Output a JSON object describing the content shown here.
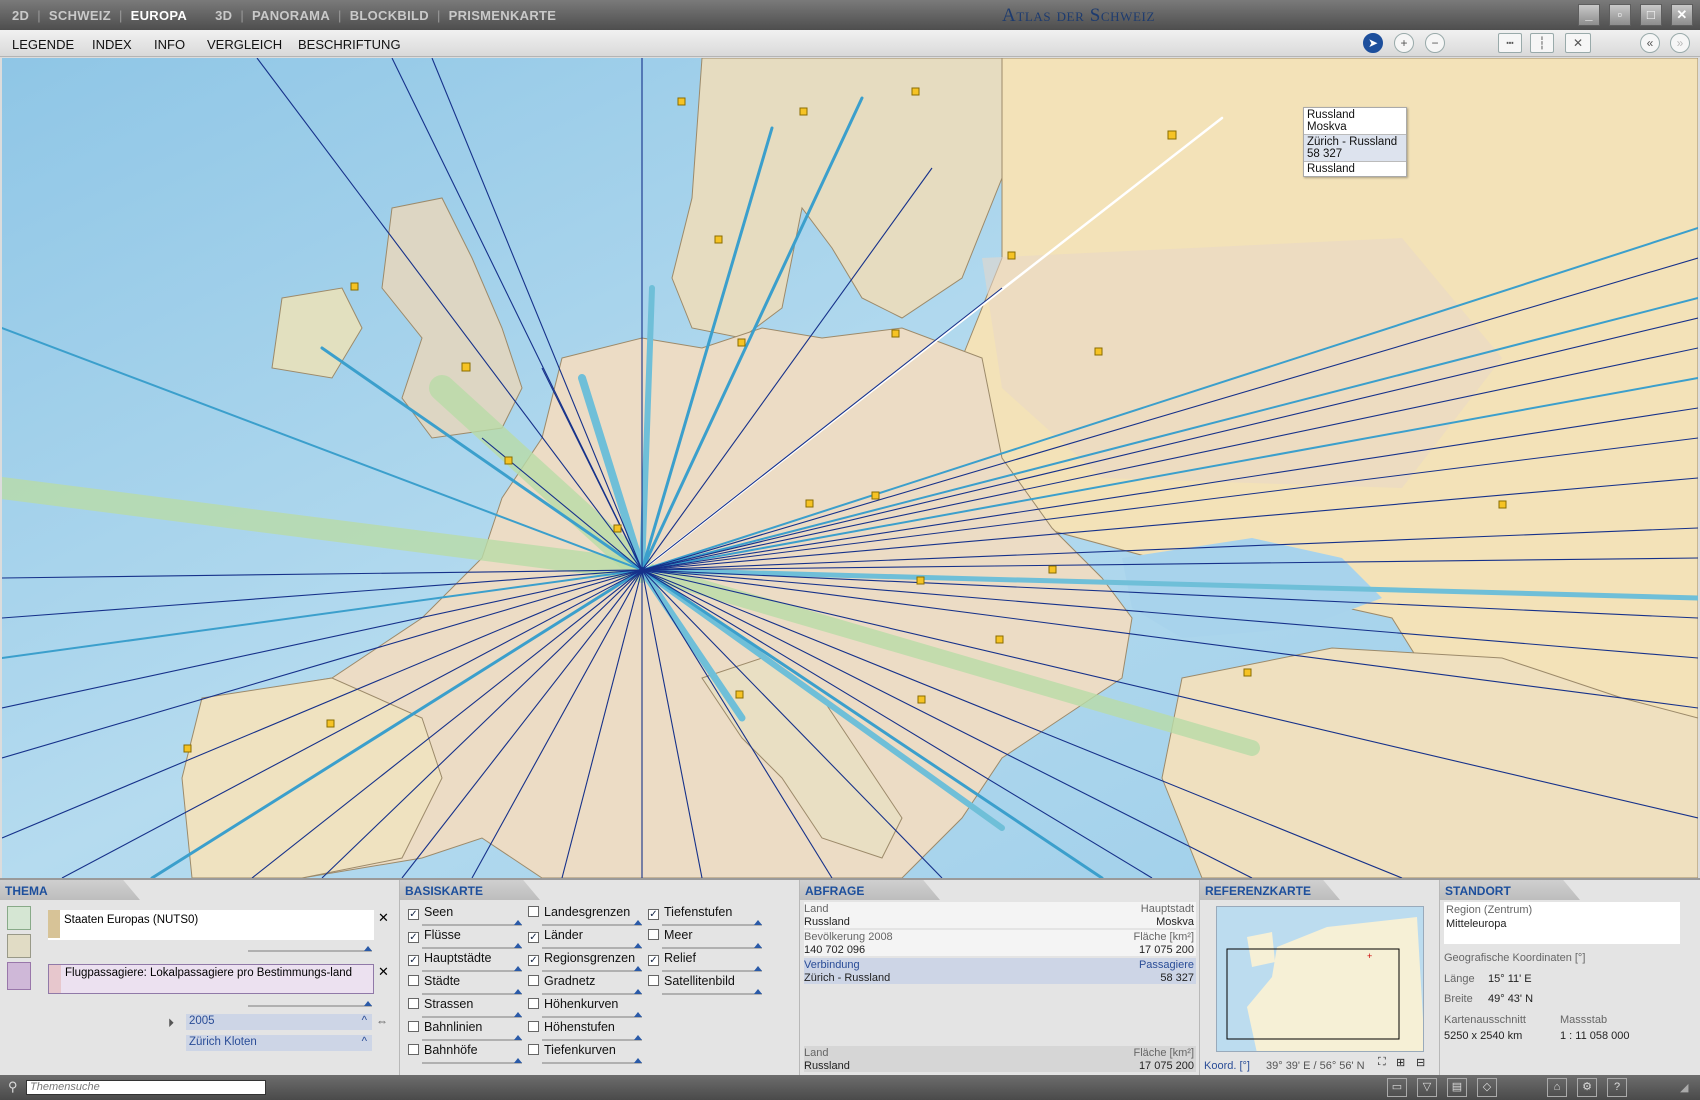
{
  "titlebar": {
    "nav": [
      "2D",
      "SCHWEIZ",
      "EUROPA",
      "3D",
      "PANORAMA",
      "BLOCKBILD",
      "PRISMENKARTE"
    ],
    "active": "EUROPA",
    "app_title": "Atlas der Schweiz"
  },
  "menubar": {
    "items": [
      "LEGENDE",
      "INDEX",
      "INFO",
      "VERGLEICH",
      "BESCHRIFTUNG"
    ]
  },
  "tooltip": {
    "country": "Russland",
    "capital": "Moskva",
    "route": "Zürich - Russland",
    "passengers": "58 327",
    "footer": "Russland"
  },
  "thema": {
    "header": "THEMA",
    "layer1": "Staaten Europas (NUTS0)",
    "layer2": "Flugpassagiere: Lokalpassagiere pro Bestimmungs-land",
    "year": "2005",
    "airport": "Zürich Kloten"
  },
  "basiskarte": {
    "header": "BASISKARTE",
    "col1": [
      {
        "label": "Seen",
        "checked": true
      },
      {
        "label": "Flüsse",
        "checked": true
      },
      {
        "label": "Hauptstädte",
        "checked": true
      },
      {
        "label": "Städte",
        "checked": false
      },
      {
        "label": "Strassen",
        "checked": false
      },
      {
        "label": "Bahnlinien",
        "checked": false
      },
      {
        "label": "Bahnhöfe",
        "checked": false
      }
    ],
    "col2": [
      {
        "label": "Landesgrenzen",
        "checked": false
      },
      {
        "label": "Länder",
        "checked": true
      },
      {
        "label": "Regionsgrenzen",
        "checked": true
      },
      {
        "label": "Gradnetz",
        "checked": false
      },
      {
        "label": "Höhenkurven",
        "checked": false
      },
      {
        "label": "Höhenstufen",
        "checked": false
      },
      {
        "label": "Tiefenkurven",
        "checked": false
      }
    ],
    "col3": [
      {
        "label": "Tiefenstufen",
        "checked": true
      },
      {
        "label": "Meer",
        "checked": false
      },
      {
        "label": "Relief",
        "checked": true
      },
      {
        "label": "Satellitenbild",
        "checked": false
      }
    ]
  },
  "abfrage": {
    "header": "ABFRAGE",
    "land_label": "Land",
    "land_value": "Russland",
    "hauptstadt_label": "Hauptstadt",
    "hauptstadt_value": "Moskva",
    "bevoelkerung_label": "Bevölkerung 2008",
    "bevoelkerung_value": "140 702 096",
    "flaeche_label": "Fläche [km²]",
    "flaeche_value": "17 075 200",
    "verbindung_label": "Verbindung",
    "verbindung_value": "Zürich - Russland",
    "passagiere_label": "Passagiere",
    "passagiere_value": "58 327",
    "footer_land_label": "Land",
    "footer_land_value": "Russland",
    "footer_flaeche_label": "Fläche [km²]",
    "footer_flaeche_value": "17 075 200"
  },
  "referenzkarte": {
    "header": "REFERENZKARTE",
    "koord_label": "Koord. [°]",
    "koord_value": "39° 39' E / 56° 56' N"
  },
  "standort": {
    "header": "STANDORT",
    "region_label": "Region (Zentrum)",
    "region_value": "Mitteleuropa",
    "geo_label": "Geografische Koordinaten [°]",
    "laenge_label": "Länge",
    "laenge_value": "15° 11' E",
    "breite_label": "Breite",
    "breite_value": "49° 43' N",
    "ausschnitt_label": "Kartenausschnitt",
    "ausschnitt_value": "5250 x 2540 km",
    "massstab_label": "Massstab",
    "massstab_value": "1 : 11 058 000"
  },
  "status": {
    "search_placeholder": "Themensuche"
  }
}
